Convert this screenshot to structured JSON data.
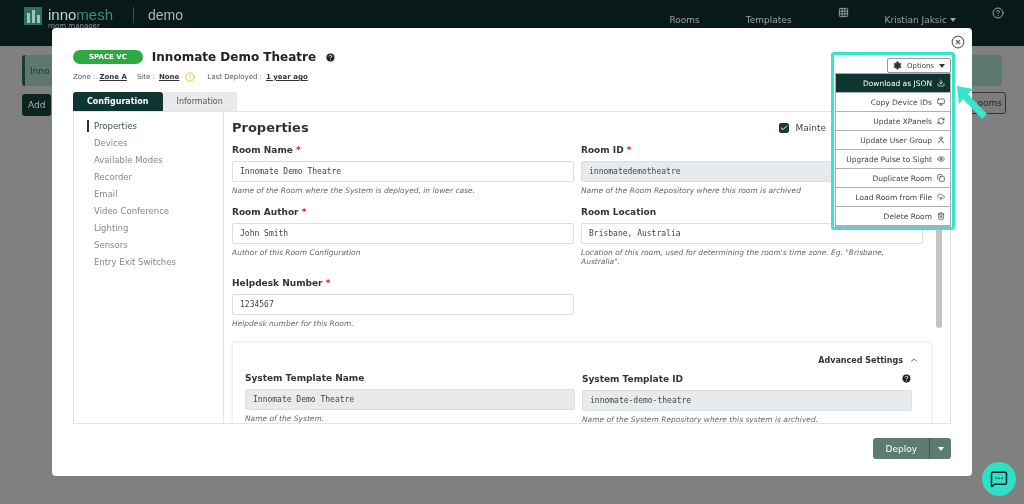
{
  "header": {
    "brand_parts": [
      "inno",
      "mesh"
    ],
    "brand_subtitle": "room manager",
    "tenant": "demo",
    "nav": [
      "Rooms",
      "Templates"
    ],
    "user": "Kristian Jaksic"
  },
  "background": {
    "banner": "Inno",
    "add_button": "Add",
    "rooms_button": "ooms"
  },
  "modal": {
    "badge": "SPACE VC",
    "title": "Innomate Demo Theatre",
    "meta": [
      {
        "label": "Zone :",
        "value": "Zone A"
      },
      {
        "label": "Site :",
        "value": "None",
        "warning": true
      },
      {
        "label": "Last Deployed :",
        "value": "1 year ago"
      }
    ],
    "tabs": [
      {
        "label": "Configuration",
        "selected": true
      },
      {
        "label": "Information",
        "selected": false
      }
    ],
    "nav": [
      {
        "label": "Properties",
        "selected": true
      },
      {
        "label": "Devices",
        "selected": false
      },
      {
        "label": "Available Modes",
        "selected": false
      },
      {
        "label": "Recorder",
        "selected": false
      },
      {
        "label": "Email",
        "selected": false
      },
      {
        "label": "Video Conference",
        "selected": false
      },
      {
        "label": "Lighting",
        "selected": false
      },
      {
        "label": "Sensors",
        "selected": false
      },
      {
        "label": "Entry Exit Switches",
        "selected": false
      }
    ],
    "heading": "Properties",
    "maintenance": {
      "label": "Mainte",
      "checked": true
    },
    "fields": [
      {
        "label": "Room Name",
        "required_mark": "*",
        "value": "Innomate Demo Theatre",
        "help": "Name of the Room where the System is deployed, in lower case.",
        "disabled": false
      },
      {
        "label": "Room ID",
        "required_mark": "*",
        "value": "innomatedemotheatre",
        "help": "Name of the Room Repository where this room is archived",
        "disabled": true
      },
      {
        "label": "Room Author",
        "required_mark": "*",
        "value": "John Smith",
        "help": "Author of this Room Configuration",
        "disabled": false
      },
      {
        "label": "Room Location",
        "value": "Brisbane, Australia",
        "help": "Location of this room, used for determining the room's time zone. Eg. \"Brisbane, Australia\".",
        "disabled": false
      },
      {
        "label": "Helpdesk Number",
        "required_mark": "*",
        "value": "1234567",
        "help": "Helpdesk number for this Room.",
        "disabled": false
      }
    ],
    "advanced": {
      "title": "Advanced Settings",
      "expanded": true,
      "fields": [
        {
          "label": "System Template Name",
          "value": "Innomate Demo Theatre",
          "help": "Name of the System.",
          "disabled": true
        },
        {
          "label": "System Template ID",
          "value": "innomate-demo-theatre",
          "help": "Name of the System Repository where this system is archived.",
          "disabled": true
        }
      ]
    },
    "deploy": "Deploy"
  },
  "options": {
    "label": "Options",
    "items": [
      {
        "label": "Download as JSON",
        "selected": true
      },
      {
        "label": "Copy Device IDs",
        "selected": false
      },
      {
        "label": "Update XPanels",
        "selected": false
      },
      {
        "label": "Update User Group",
        "selected": false
      },
      {
        "label": "Upgrade Pulse to Sight",
        "selected": false
      },
      {
        "label": "Duplicate Room",
        "selected": false
      },
      {
        "label": "Load Room from File",
        "selected": false
      },
      {
        "label": "Delete Room",
        "selected": false
      }
    ]
  }
}
